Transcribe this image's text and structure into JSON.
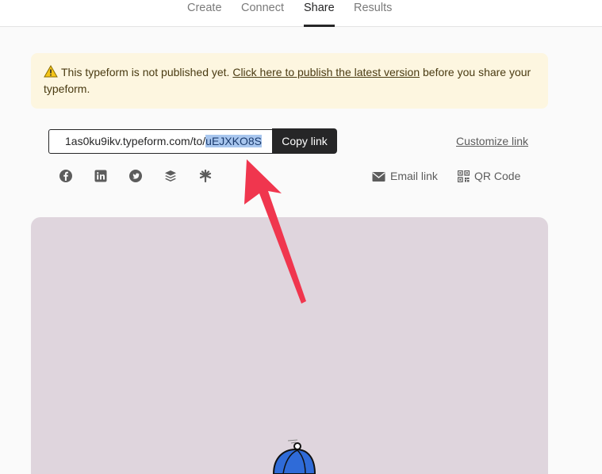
{
  "nav": {
    "tabs": [
      {
        "label": "Create"
      },
      {
        "label": "Connect"
      },
      {
        "label": "Share"
      },
      {
        "label": "Results"
      }
    ],
    "active": "Share"
  },
  "banner": {
    "icon": "warning-icon",
    "text_before": "This typeform is not published yet.",
    "link_text": "Click here to publish the latest version",
    "text_after": "before you share your typeform."
  },
  "share": {
    "url_prefix": "1as0ku9ikv.typeform.com/to/",
    "url_selected": "uEJXKO8S",
    "copy_label": "Copy link",
    "customize_label": "Customize link",
    "social_icons": [
      "facebook-icon",
      "linkedin-icon",
      "twitter-icon",
      "buffer-icon",
      "linktree-icon"
    ],
    "email_label": "Email link",
    "qr_label": "QR Code"
  },
  "colors": {
    "accent_dark": "#262627",
    "banner_bg": "#fdf6e0",
    "preview_bg": "#dfd5dd",
    "selection": "#a8c6ee",
    "arrow_red": "#f0364e",
    "umbrella_blue": "#2f6bd8"
  }
}
